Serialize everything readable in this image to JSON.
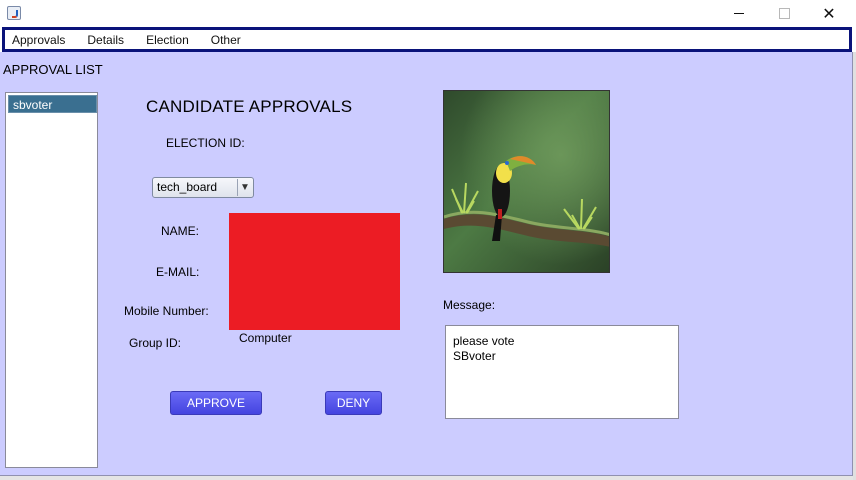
{
  "window": {
    "close_glyph": "✕"
  },
  "menu": {
    "items": [
      "Approvals",
      "Details",
      "Election",
      "Other"
    ]
  },
  "approval_list": {
    "label": "APPROVAL LIST",
    "items": [
      "sbvoter"
    ],
    "selected_index": 0
  },
  "form": {
    "heading": "CANDIDATE APPROVALS",
    "election_id_label": "ELECTION  ID:",
    "election_select": {
      "value": "tech_board"
    },
    "name_label": "NAME:",
    "email_label": "E-MAIL:",
    "mobile_label": "Mobile Number:",
    "group_id_label": "Group ID:",
    "group_id_value": "Computer",
    "redaction_color": "#ec1c24"
  },
  "buttons": {
    "approve_label": "APPROVE",
    "deny_label": "DENY",
    "accent_color": "#5555ee"
  },
  "photo": {
    "subject": "toucan-on-branch-photo"
  },
  "message": {
    "label": "Message:",
    "lines": [
      "please vote",
      "SBvoter"
    ]
  },
  "colors": {
    "panel_background": "#ccccff",
    "menubar_border": "#0a137a",
    "list_selection": "#3a6f90"
  }
}
